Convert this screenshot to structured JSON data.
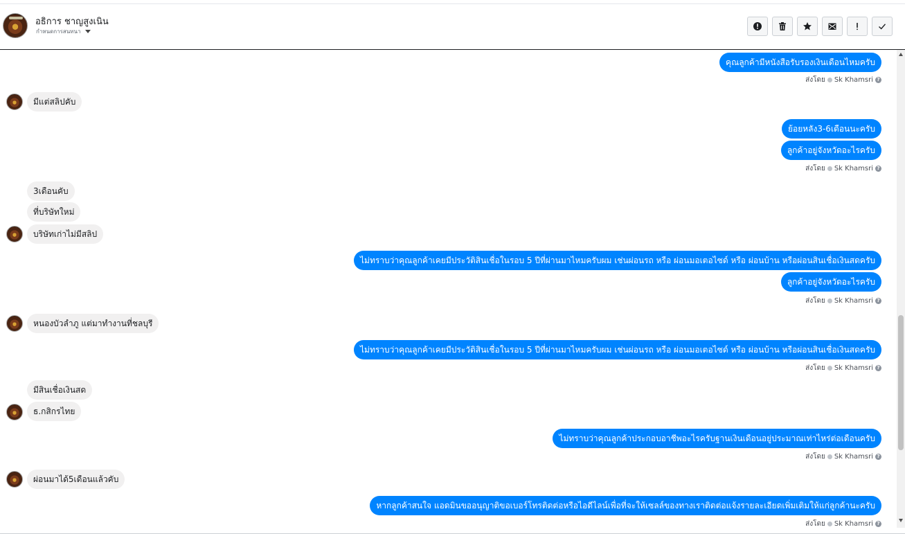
{
  "header": {
    "contact_name": "อธิการ ชาญสูงเนิน",
    "subtitle": "กำหนดการสนทนา",
    "actions": [
      {
        "icon": "alert-circle-icon",
        "name": "spam-button"
      },
      {
        "icon": "trash-icon",
        "name": "delete-button"
      },
      {
        "icon": "star-icon",
        "name": "star-button"
      },
      {
        "icon": "mail-icon",
        "name": "mark-unread-button"
      },
      {
        "icon": "exclamation-icon",
        "name": "follow-up-button"
      },
      {
        "icon": "check-icon",
        "name": "done-button"
      }
    ]
  },
  "sender_label": "ส่งโดย",
  "sender_name": "Sk Khamsri",
  "messages": [
    {
      "dir": "out",
      "text": "คุณลูกค้ามีหนังสือรับรองเงินเดือนไหมครับ"
    },
    {
      "dir": "in",
      "text": "มีแต่สลิปคับ"
    },
    {
      "dir": "out",
      "text": "ย้อยหลัง3-6เดือนนะครับ"
    },
    {
      "dir": "out",
      "text": "ลูกค้าอยู่จังหวัดอะไรครับ"
    },
    {
      "dir": "in",
      "text": "3เดือนคับ"
    },
    {
      "dir": "in",
      "text": "ที่บริษัทใหม่"
    },
    {
      "dir": "in",
      "text": "บริษัทเก่าไม่มีสลิป"
    },
    {
      "dir": "out",
      "text": "ไม่ทราบว่าคุณลูกค้าเคยมีประวัติสินเชื่อในรอบ 5 ปีที่ผ่านมาไหมครับผม เช่นผ่อนรถ หรือ ผ่อนมอเตอไซด์ หรือ ผ่อนบ้าน หรือผ่อนสินเชื่อเงินสดครับ"
    },
    {
      "dir": "out",
      "text": "ลูกค้าอยู่จังหวัดอะไรครับ"
    },
    {
      "dir": "in",
      "text": "หนองบัวลำภู แต่มาทำงานที่ชลบุรี"
    },
    {
      "dir": "out",
      "text": "ไม่ทราบว่าคุณลูกค้าเคยมีประวัติสินเชื่อในรอบ 5 ปีที่ผ่านมาไหมครับผม เช่นผ่อนรถ หรือ ผ่อนมอเตอไซด์ หรือ ผ่อนบ้าน หรือผ่อนสินเชื่อเงินสดครับ"
    },
    {
      "dir": "in",
      "text": "มีสินเชื่อเงินสด"
    },
    {
      "dir": "in",
      "text": "ธ.กสิกรไทย"
    },
    {
      "dir": "out",
      "text": "ไม่ทราบว่าคุณลูกค้าประกอบอาชีพอะไรครับฐานเงินเดือนอยู่ประมาณเท่าไหร่ต่อเดือนครับ"
    },
    {
      "dir": "in",
      "text": "ผ่อนมาได้5เดือนแล้วคับ"
    },
    {
      "dir": "out",
      "text": "หากลูกค้าสนใจ แอดมินขออนุญาติขอเบอร์โทรติดต่อหรือไอดีไลน์เพื่อที่จะให้เซลล์ของทางเราติดต่อแจ้งรายละเอียดเพิ่มเติมให้แก่ลูกค้านะครับ"
    }
  ]
}
